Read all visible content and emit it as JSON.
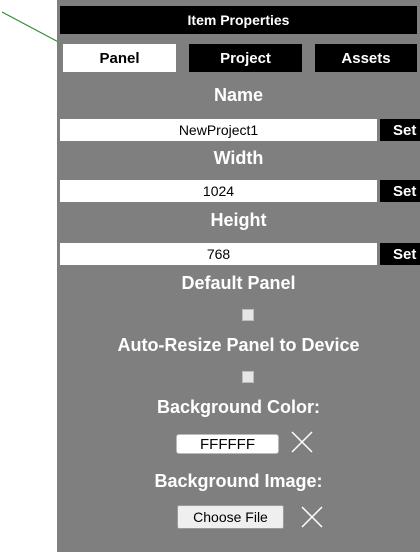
{
  "window": {
    "title": "Item Properties"
  },
  "tabs": [
    {
      "label": "Panel",
      "active": true
    },
    {
      "label": "Project",
      "active": false
    },
    {
      "label": "Assets",
      "active": false
    }
  ],
  "fields": {
    "name": {
      "label": "Name",
      "value": "NewProject1",
      "button": "Set"
    },
    "width": {
      "label": "Width",
      "value": "1024",
      "button": "Set"
    },
    "height": {
      "label": "Height",
      "value": "768",
      "button": "Set"
    }
  },
  "options": {
    "default_panel": {
      "label": "Default Panel",
      "checked": false
    },
    "auto_resize": {
      "label": "Auto-Resize Panel to Device",
      "checked": false
    }
  },
  "background_color": {
    "label": "Background Color:",
    "value": "FFFFFF"
  },
  "background_image": {
    "label": "Background Image:",
    "button": "Choose File"
  },
  "icons": {
    "clear": "close-x-icon",
    "pointer": "arrow-pointer-icon"
  },
  "colors": {
    "panel_bg": "#7f7f7f",
    "header_bg": "#000000",
    "label_text": "#ffffff",
    "arrow": "#2a8a2a"
  }
}
